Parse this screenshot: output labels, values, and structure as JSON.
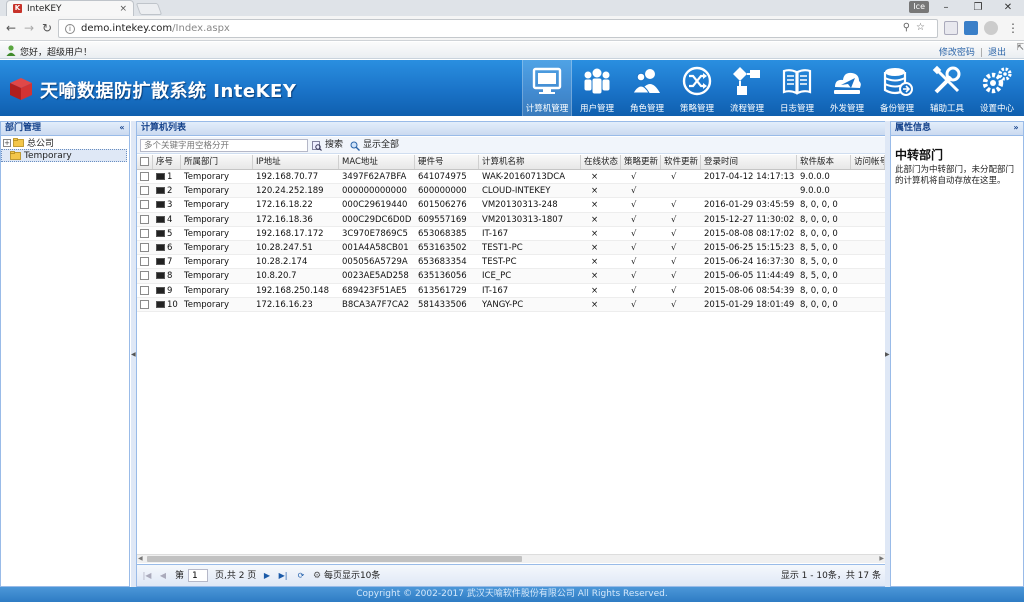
{
  "browser": {
    "tab_title": "InteKEY",
    "tab_close": "×",
    "user_badge": "Ice",
    "url_host": "demo.intekey.com",
    "url_path": "/Index.aspx"
  },
  "greeting": {
    "text": "您好，超级用户！",
    "change_password": "修改密码",
    "separator": "|",
    "logout": "退出"
  },
  "header": {
    "system_title": "天喻数据防扩散系统 InteKEY",
    "nav": [
      {
        "label": "计算机管理",
        "icon": "monitor-icon",
        "active": true
      },
      {
        "label": "用户管理",
        "icon": "users-icon"
      },
      {
        "label": "角色管理",
        "icon": "roles-icon"
      },
      {
        "label": "策略管理",
        "icon": "shuffle-icon"
      },
      {
        "label": "流程管理",
        "icon": "flow-icon"
      },
      {
        "label": "日志管理",
        "icon": "book-icon"
      },
      {
        "label": "外发管理",
        "icon": "send-icon"
      },
      {
        "label": "备份管理",
        "icon": "backup-icon"
      },
      {
        "label": "辅助工具",
        "icon": "tools-icon"
      },
      {
        "label": "设置中心",
        "icon": "gears-icon"
      }
    ]
  },
  "left_panel": {
    "title": "部门管理",
    "collapse": "«",
    "tree": [
      {
        "label": "总公司",
        "toggle": "+"
      },
      {
        "label": "Temporary"
      }
    ]
  },
  "grid": {
    "title": "计算机列表",
    "search_placeholder": "多个关键字用空格分开",
    "search_btn": "搜索",
    "show_all_btn": "显示全部",
    "columns": [
      "序号",
      "所属部门",
      "IP地址",
      "MAC地址",
      "硬件号",
      "计算机名称",
      "在线状态",
      "策略更新",
      "软件更新",
      "登录时间",
      "软件版本",
      "访问帐号"
    ],
    "rows": [
      [
        "1",
        "Temporary",
        "192.168.70.77",
        "3497F62A7BFA",
        "641074975",
        "WAK-20160713DCA",
        "×",
        "√",
        "√",
        "2017-04-12 14:17:13",
        "9.0.0.0",
        ""
      ],
      [
        "2",
        "Temporary",
        "120.24.252.189",
        "000000000000",
        "600000000",
        "CLOUD-INTEKEY",
        "×",
        "√",
        "",
        "",
        "9.0.0.0",
        ""
      ],
      [
        "3",
        "Temporary",
        "172.16.18.22",
        "000C29619440",
        "601506276",
        "VM20130313-248",
        "×",
        "√",
        "√",
        "2016-01-29 03:45:59",
        "8, 0, 0, 0",
        ""
      ],
      [
        "4",
        "Temporary",
        "172.16.18.36",
        "000C29DC6D0D",
        "609557169",
        "VM20130313-1807",
        "×",
        "√",
        "√",
        "2015-12-27 11:30:02",
        "8, 0, 0, 0",
        ""
      ],
      [
        "5",
        "Temporary",
        "192.168.17.172",
        "3C970E7869C5",
        "653068385",
        "IT-167",
        "×",
        "√",
        "√",
        "2015-08-08 08:17:02",
        "8, 0, 0, 0",
        ""
      ],
      [
        "6",
        "Temporary",
        "10.28.247.51",
        "001A4A58CB01",
        "653163502",
        "TEST1-PC",
        "×",
        "√",
        "√",
        "2015-06-25 15:15:23",
        "8, 5, 0, 0",
        ""
      ],
      [
        "7",
        "Temporary",
        "10.28.2.174",
        "005056A5729A",
        "653683354",
        "TEST-PC",
        "×",
        "√",
        "√",
        "2015-06-24 16:37:30",
        "8, 5, 0, 0",
        ""
      ],
      [
        "8",
        "Temporary",
        "10.8.20.7",
        "0023AE5AD258",
        "635136056",
        "ICE_PC",
        "×",
        "√",
        "√",
        "2015-06-05 11:44:49",
        "8, 5, 0, 0",
        ""
      ],
      [
        "9",
        "Temporary",
        "192.168.250.148",
        "689423F51AE5",
        "613561729",
        "IT-167",
        "×",
        "√",
        "√",
        "2015-08-06 08:54:39",
        "8, 0, 0, 0",
        ""
      ],
      [
        "10",
        "Temporary",
        "172.16.16.23",
        "B8CA3A7F7CA2",
        "581433506",
        "YANGY-PC",
        "×",
        "√",
        "√",
        "2015-01-29 18:01:49",
        "8, 0, 0, 0",
        ""
      ]
    ]
  },
  "pager": {
    "page_label": "第",
    "current_page": "1",
    "total_label": "页,共 2 页",
    "per_page_label": "每页显示10条",
    "status": "显示 1 - 10条，共 17 条"
  },
  "right_panel": {
    "title": "属性信息",
    "expand": "»",
    "heading": "中转部门",
    "description": "此部门为中转部门，未分配部门的计算机将自动存放在这里。"
  },
  "footer": {
    "copyright": "Copyright © 2002-2017 武汉天喻软件股份有限公司 All Rights Reserved."
  }
}
